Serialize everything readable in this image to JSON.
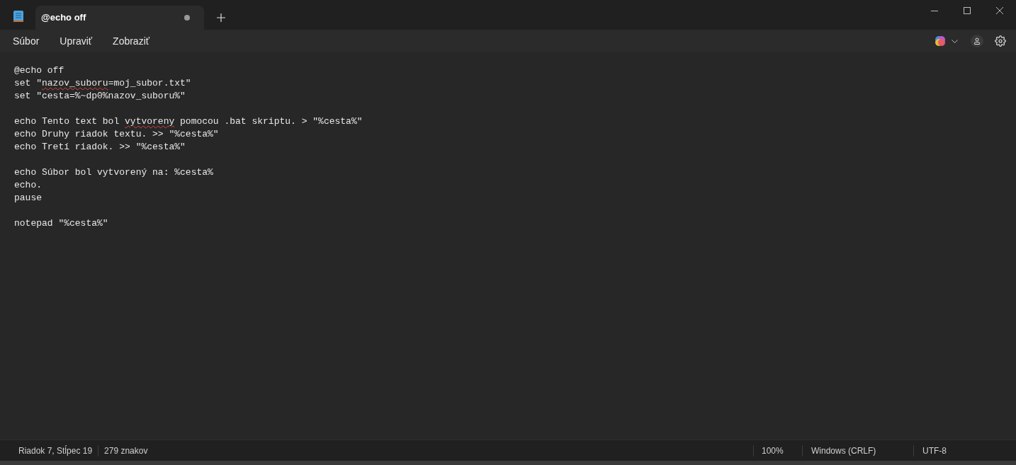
{
  "tab": {
    "title": "@echo off",
    "modified": true
  },
  "menu": [
    "Súbor",
    "Upraviť",
    "Zobraziť"
  ],
  "lines": [
    {
      "kind": "code",
      "segments": [
        {
          "text": "@echo off",
          "misspelled": false
        }
      ]
    },
    {
      "kind": "code",
      "segments": [
        {
          "text": "set \"",
          "misspelled": false
        },
        {
          "text": "nazov_suboru",
          "misspelled": true
        },
        {
          "text": "=moj_subor.txt\"",
          "misspelled": false
        }
      ]
    },
    {
      "kind": "code",
      "segments": [
        {
          "text": "set \"cesta=%~dp0%nazov_suboru%\"",
          "misspelled": false
        }
      ]
    },
    {
      "kind": "blank"
    },
    {
      "kind": "code",
      "segments": [
        {
          "text": "echo Tento text bol ",
          "misspelled": false
        },
        {
          "text": "vytvoreny",
          "misspelled": true
        },
        {
          "text": " pomocou .bat skriptu. > \"%cesta%\"",
          "misspelled": false
        }
      ]
    },
    {
      "kind": "code",
      "segments": [
        {
          "text": "echo Druhy riadok textu. >> \"%cesta%\"",
          "misspelled": false
        }
      ]
    },
    {
      "kind": "code",
      "segments": [
        {
          "text": "echo Tretí riadok. >> \"%cesta%\"",
          "misspelled": false
        }
      ]
    },
    {
      "kind": "blank"
    },
    {
      "kind": "code",
      "segments": [
        {
          "text": "echo Súbor bol vytvorený na: %cesta%",
          "misspelled": false
        }
      ]
    },
    {
      "kind": "code",
      "segments": [
        {
          "text": "echo.",
          "misspelled": false
        }
      ]
    },
    {
      "kind": "code",
      "segments": [
        {
          "text": "pause",
          "misspelled": false
        }
      ]
    },
    {
      "kind": "blank"
    },
    {
      "kind": "code",
      "segments": [
        {
          "text": "notepad \"%cesta%\"",
          "misspelled": false
        }
      ]
    }
  ],
  "status_bar": {
    "position": "Riadok 7, Stĺpec 19",
    "characters": "279 znakov",
    "zoom": "100%",
    "line_ending": "Windows (CRLF)",
    "encoding": "UTF-8"
  }
}
